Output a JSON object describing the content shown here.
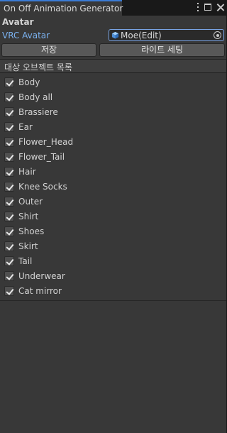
{
  "window": {
    "tab_title": "On Off Animation Generator"
  },
  "avatar_section": {
    "title": "Avatar",
    "field_label": "VRC Avatar",
    "field_value": "Moe(Edit)"
  },
  "buttons": {
    "save": "저장",
    "light_settings": "라이트 세팅"
  },
  "target_list": {
    "header": "대상 오브젝트 목록",
    "items": [
      {
        "label": "Body",
        "checked": true
      },
      {
        "label": "Body all",
        "checked": true
      },
      {
        "label": "Brassiere",
        "checked": true
      },
      {
        "label": "Ear",
        "checked": true
      },
      {
        "label": "Flower_Head",
        "checked": true
      },
      {
        "label": "Flower_Tail",
        "checked": true
      },
      {
        "label": "Hair",
        "checked": true
      },
      {
        "label": "Knee Socks",
        "checked": true
      },
      {
        "label": "Outer",
        "checked": true
      },
      {
        "label": "Shirt",
        "checked": true
      },
      {
        "label": "Shoes",
        "checked": true
      },
      {
        "label": "Skirt",
        "checked": true
      },
      {
        "label": "Tail",
        "checked": true
      },
      {
        "label": "Underwear",
        "checked": true
      },
      {
        "label": "Cat mirror",
        "checked": true
      }
    ]
  },
  "icons": {
    "menu": "kebab-menu-icon",
    "maximize": "maximize-icon",
    "close": "close-icon",
    "avatar_object": "prefab-cube-icon",
    "object_picker": "object-picker-icon",
    "checkbox": "checkmark-icon"
  },
  "colors": {
    "accent_blue": "#3a7bd5",
    "label_blue": "#7bb2f0",
    "panel_bg": "#383838"
  }
}
